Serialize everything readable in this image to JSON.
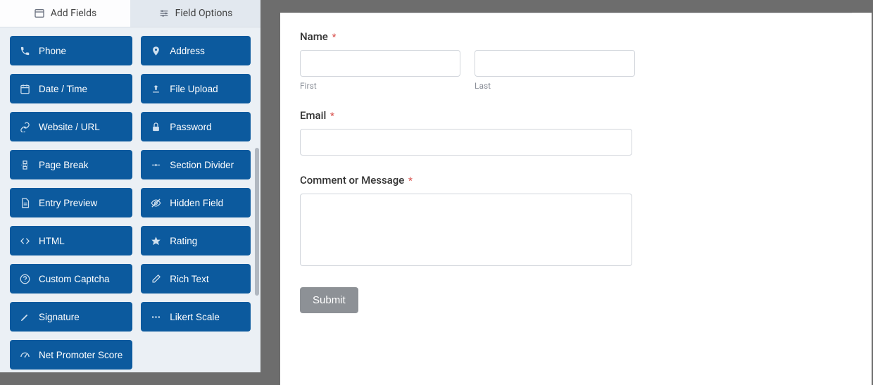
{
  "sidebar": {
    "tabs": {
      "add_fields": "Add Fields",
      "field_options": "Field Options"
    },
    "fields": [
      {
        "id": "phone",
        "label": "Phone",
        "icon": "phone-icon"
      },
      {
        "id": "address",
        "label": "Address",
        "icon": "pin-icon"
      },
      {
        "id": "datetime",
        "label": "Date / Time",
        "icon": "calendar-icon"
      },
      {
        "id": "fileupload",
        "label": "File Upload",
        "icon": "upload-icon"
      },
      {
        "id": "website",
        "label": "Website / URL",
        "icon": "link-icon"
      },
      {
        "id": "password",
        "label": "Password",
        "icon": "lock-icon"
      },
      {
        "id": "pagebreak",
        "label": "Page Break",
        "icon": "pagebreak-icon"
      },
      {
        "id": "sectiondivider",
        "label": "Section Divider",
        "icon": "divider-icon"
      },
      {
        "id": "entrypreview",
        "label": "Entry Preview",
        "icon": "file-icon"
      },
      {
        "id": "hiddenfield",
        "label": "Hidden Field",
        "icon": "eyeoff-icon"
      },
      {
        "id": "html",
        "label": "HTML",
        "icon": "code-icon"
      },
      {
        "id": "rating",
        "label": "Rating",
        "icon": "star-icon"
      },
      {
        "id": "customcaptcha",
        "label": "Custom Captcha",
        "icon": "questioncircle-icon"
      },
      {
        "id": "richtext",
        "label": "Rich Text",
        "icon": "edit-icon"
      },
      {
        "id": "signature",
        "label": "Signature",
        "icon": "pencil-icon"
      },
      {
        "id": "likert",
        "label": "Likert Scale",
        "icon": "dots-icon"
      },
      {
        "id": "nps",
        "label": "Net Promoter Score",
        "icon": "gauge-icon"
      }
    ]
  },
  "form": {
    "name": {
      "label": "Name",
      "first_sub": "First",
      "last_sub": "Last"
    },
    "email": {
      "label": "Email"
    },
    "message": {
      "label": "Comment or Message"
    },
    "submit": "Submit"
  }
}
